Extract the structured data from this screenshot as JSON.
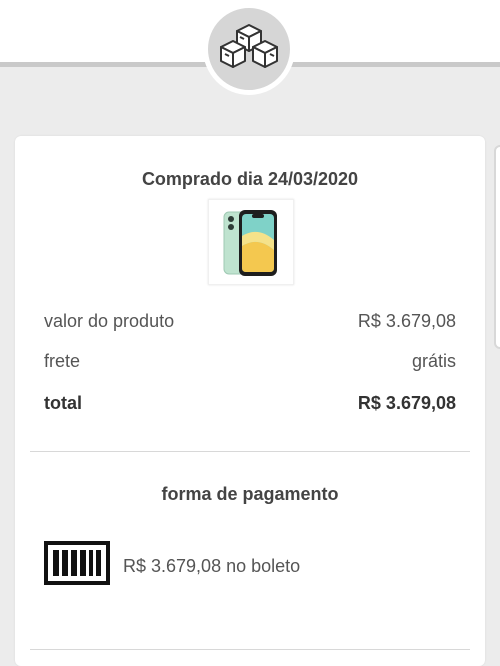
{
  "order": {
    "purchased_label": "Comprado dia 24/03/2020",
    "product_image": "phone-image"
  },
  "summary": {
    "rows": [
      {
        "label": "valor do produto",
        "value": "R$ 3.679,08"
      },
      {
        "label": "frete",
        "value": "grátis"
      },
      {
        "label": "total",
        "value": "R$ 3.679,08"
      }
    ]
  },
  "payment": {
    "title": "forma de pagamento",
    "text": "R$ 3.679,08 no boleto",
    "icon": "barcode-icon"
  },
  "colors": {
    "background": "#ececec",
    "card": "#ffffff",
    "phone_green": "#bfe3cf"
  }
}
